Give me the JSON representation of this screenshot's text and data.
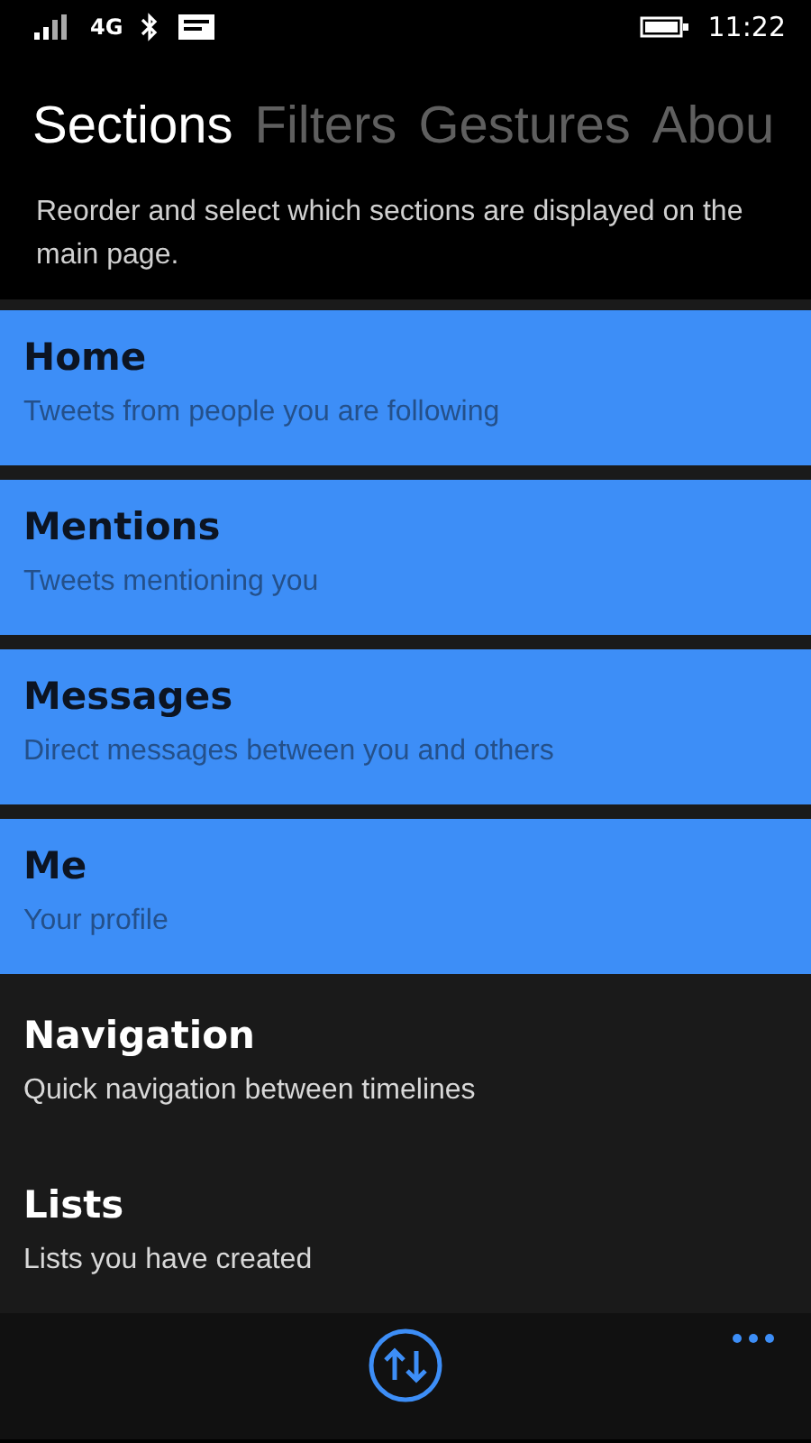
{
  "status_bar": {
    "network": "4G",
    "time": "11:22"
  },
  "tabs": [
    {
      "label": "Sections",
      "selected": true
    },
    {
      "label": "Filters",
      "selected": false
    },
    {
      "label": "Gestures",
      "selected": false
    },
    {
      "label": "Abou",
      "selected": false
    }
  ],
  "description": "Reorder and select which sections are displayed on the main page.",
  "sections": [
    {
      "title": "Home",
      "subtitle": "Tweets from people you are following",
      "selected": true
    },
    {
      "title": "Mentions",
      "subtitle": "Tweets mentioning you",
      "selected": true
    },
    {
      "title": "Messages",
      "subtitle": "Direct messages between you and others",
      "selected": true
    },
    {
      "title": "Me",
      "subtitle": "Your profile",
      "selected": true
    },
    {
      "title": "Navigation",
      "subtitle": "Quick navigation between timelines",
      "selected": false
    },
    {
      "title": "Lists",
      "subtitle": "Lists you have created",
      "selected": false
    }
  ]
}
